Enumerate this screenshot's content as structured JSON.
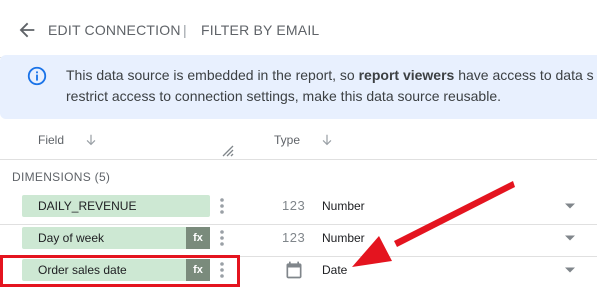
{
  "toolbar": {
    "edit_connection": "EDIT CONNECTION",
    "separator": "|",
    "filter_by_email": "FILTER BY EMAIL"
  },
  "banner": {
    "line1_start": "This data source is embedded in the report, so ",
    "line1_bold": "report viewers",
    "line1_end": " have access to data s",
    "line2": "restrict access to connection settings, make this data source reusable."
  },
  "table_header": {
    "field": "Field",
    "type": "Type"
  },
  "section": {
    "dimensions": "DIMENSIONS (5)"
  },
  "rows": [
    {
      "name": "DAILY_REVENUE",
      "has_fx": false,
      "type_icon": "123",
      "type": "Number"
    },
    {
      "name": "Day of week",
      "has_fx": true,
      "fx": "fx",
      "type_icon": "123",
      "type": "Number"
    },
    {
      "name": "Order sales date",
      "has_fx": true,
      "fx": "fx",
      "type_icon": "calendar-icon",
      "type": "Date"
    }
  ],
  "colors": {
    "accent": "#1a73e8",
    "banner_bg": "#e8f0fe",
    "pill_bg": "#cde8d3",
    "fx_bg": "#7a8b7c",
    "annotation_red": "#e4141f"
  }
}
